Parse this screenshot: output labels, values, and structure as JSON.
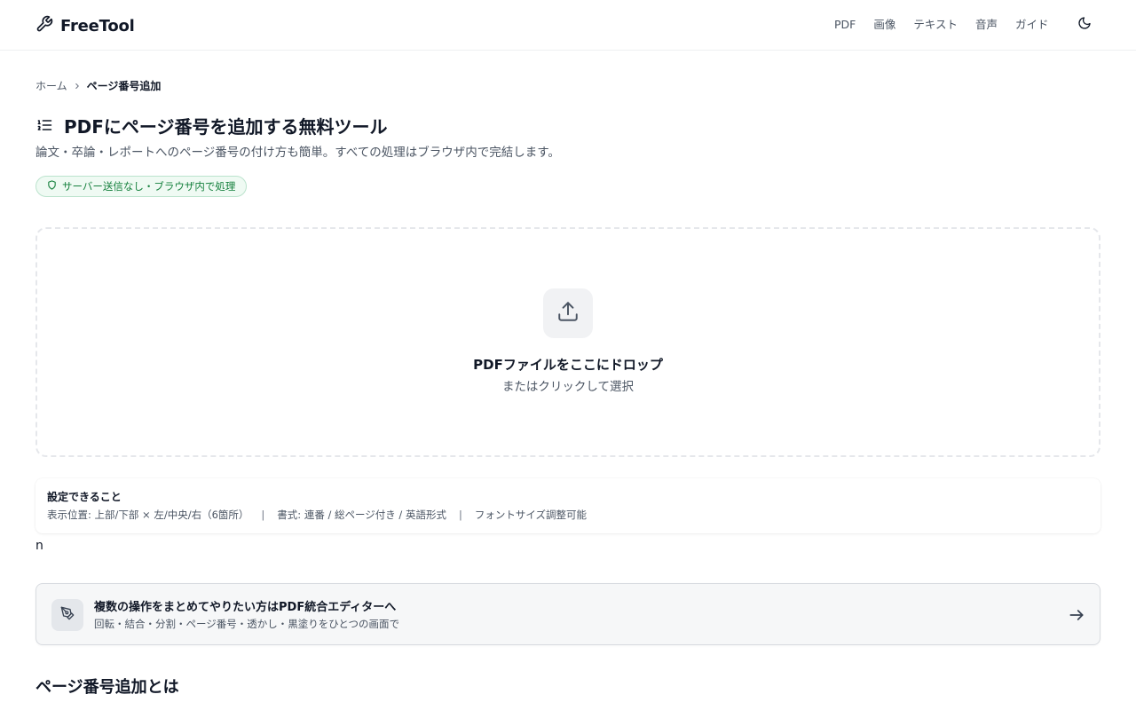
{
  "header": {
    "logo_text": "FreeTool",
    "nav": [
      "PDF",
      "画像",
      "テキスト",
      "音声",
      "ガイド"
    ]
  },
  "breadcrumb": {
    "home": "ホーム",
    "current": "ページ番号追加"
  },
  "page": {
    "title": "PDFにページ番号を追加する無料ツール",
    "subtitle": "論文・卒論・レポートへのページ番号の付け方も簡単。すべての処理はブラウザ内で完結します。",
    "badge": "サーバー送信なし・ブラウザ内で処理"
  },
  "dropzone": {
    "title": "PDFファイルをここにドロップ",
    "subtitle": "またはクリックして選択"
  },
  "features": {
    "title": "設定できること",
    "items": [
      "表示位置: 上部/下部 × 左/中央/右（6箇所）",
      "書式: 連番 / 総ページ付き / 英語形式",
      "フォントサイズ調整可能"
    ],
    "separator": "|"
  },
  "stray_text": "n",
  "editor_link": {
    "title": "複数の操作をまとめてやりたい方はPDF統合エディターへ",
    "subtitle": "回転・結合・分割・ページ番号・透かし・黒塗りをひとつの画面で"
  },
  "section": {
    "heading": "ページ番号追加とは"
  },
  "colors": {
    "badge_green": "#15803d",
    "badge_bg": "#effaf3",
    "text_primary": "#111827",
    "text_secondary": "#4b5563"
  },
  "icons": {
    "logo": "wrench-icon",
    "theme": "moon-icon",
    "breadcrumb_sep": "chevron-right-icon",
    "title": "numbered-list-icon",
    "badge": "shield-icon",
    "upload": "upload-icon",
    "editor": "pen-tool-icon",
    "editor_arrow": "arrow-right-icon"
  }
}
